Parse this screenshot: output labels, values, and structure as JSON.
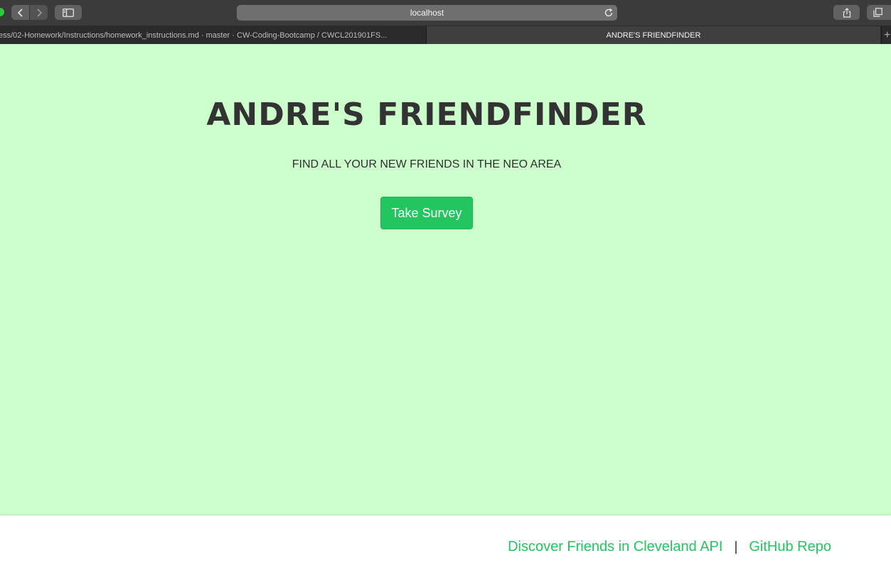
{
  "browser": {
    "address": "localhost",
    "tabs": [
      {
        "title": "ess/02-Homework/Instructions/homework_instructions.md · master · CW-Coding-Bootcamp / CWCL201901FS...",
        "active": false
      },
      {
        "title": "ANDRE'S FRIENDFINDER",
        "active": true
      }
    ],
    "new_tab_label": "+"
  },
  "hero": {
    "title": "ANDRE'S FRIENDFINDER",
    "subtitle": "FIND ALL YOUR NEW FRIENDS IN THE NEO AREA",
    "button_label": "Take Survey"
  },
  "footer": {
    "links": [
      {
        "label": "Discover Friends in Cleveland API"
      },
      {
        "label": "GitHub Repo"
      }
    ],
    "separator": "|"
  },
  "colors": {
    "page_background": "#ccffcc",
    "accent": "#22c55e",
    "title_text": "#333333"
  }
}
